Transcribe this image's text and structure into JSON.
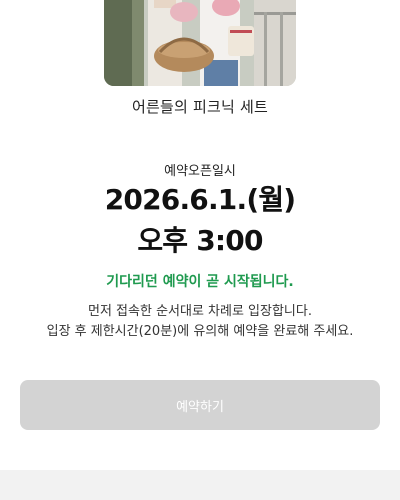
{
  "product": {
    "name": "어른들의 피크닉 세트",
    "image_alt": "product-photo"
  },
  "reservation": {
    "open_label": "예약오픈일시",
    "open_date": "2026.6.1.(월)",
    "open_time": "오후 3:00",
    "status_message": "기다리던 예약이 곧 시작됩니다.",
    "notice_lines": [
      "먼저 접속한 순서대로 차례로 입장합니다.",
      "입장 후 제한시간(20분)에 유의해 예약을 완료해 주세요."
    ],
    "button_label": "예약하기",
    "button_enabled": false
  },
  "colors": {
    "status_green": "#1f9a4f",
    "button_disabled_bg": "#d3d3d3",
    "button_disabled_text": "#ffffff",
    "bottom_band": "#f2f2f2"
  }
}
